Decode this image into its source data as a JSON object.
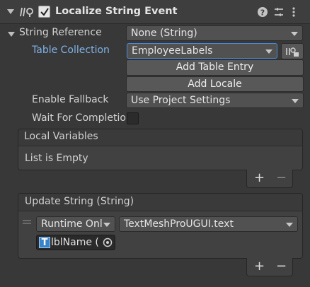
{
  "component": {
    "title": "Localize String Event",
    "enabled": true
  },
  "string_reference": {
    "label": "String Reference",
    "value": "None (String)"
  },
  "table_collection": {
    "label": "Table Collection",
    "value": "EmployeeLabels"
  },
  "buttons": {
    "add_table_entry": "Add Table Entry",
    "add_locale": "Add Locale"
  },
  "enable_fallback": {
    "label": "Enable Fallback",
    "value": "Use Project Settings"
  },
  "wait_for_completion": {
    "label": "Wait For Completio",
    "checked": false
  },
  "local_variables": {
    "header": "Local Variables",
    "empty_text": "List is Empty",
    "add": "+",
    "remove": "−"
  },
  "update_string": {
    "header": "Update String (String)",
    "runtime": "Runtime Onl",
    "function": "TextMeshProUGUI.text",
    "target": "lblName (",
    "add": "+",
    "remove": "−"
  }
}
